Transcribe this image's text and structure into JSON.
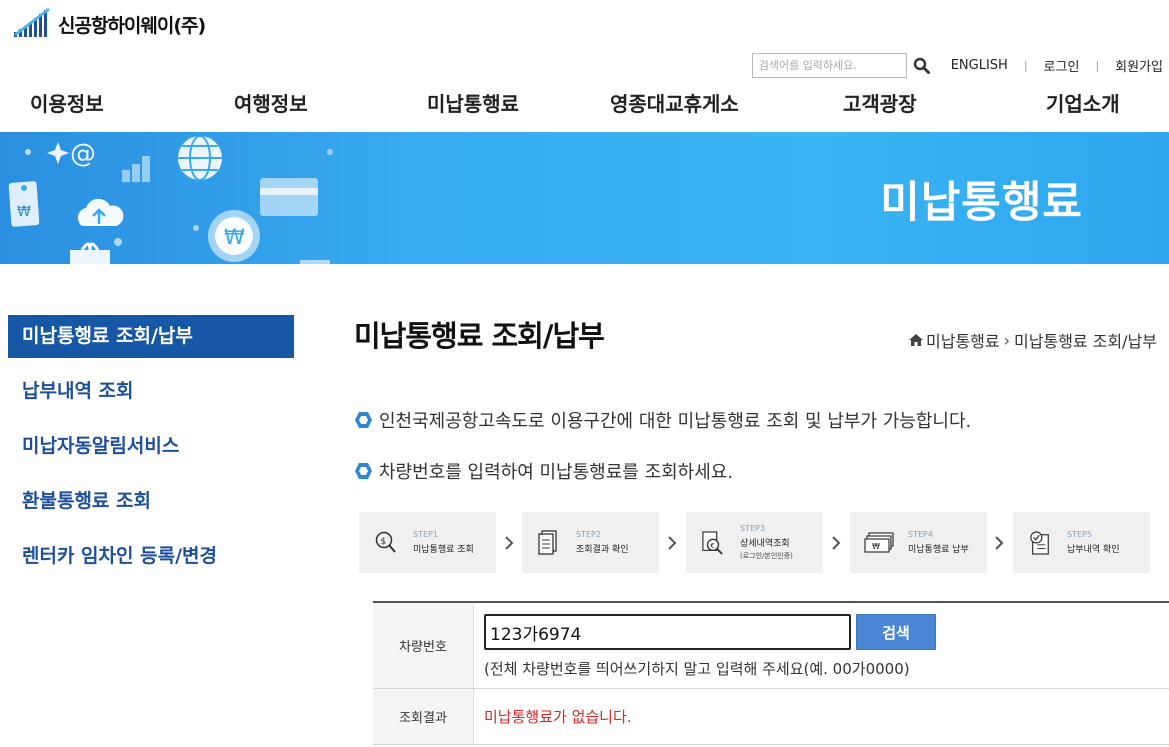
{
  "logo": {
    "text": "신공항하이웨이(주)"
  },
  "util": {
    "search_placeholder": "검색어를 입력하세요.",
    "links": [
      "ENGLISH",
      "로그인",
      "회원가입"
    ],
    "separator": "|"
  },
  "gnb": [
    "이용정보",
    "여행정보",
    "미납통행료",
    "영종대교휴게소",
    "고객광장",
    "기업소개"
  ],
  "banner": {
    "title": "미납통행료"
  },
  "lnb": [
    "미납통행료 조회/납부",
    "납부내역 조회",
    "미납자동알림서비스",
    "환불통행료 조회",
    "렌터카 임차인 등록/변경"
  ],
  "page": {
    "title": "미납통행료 조회/납부",
    "breadcrumb": [
      "미납통행료",
      "미납통행료 조회/납부"
    ],
    "chevron": "›",
    "info": [
      "인천국제공항고속도로 이용구간에 대한 미납통행료 조회 및 납부가 가능합니다.",
      "차량번호를 입력하여 미납통행료를 조회하세요."
    ]
  },
  "steps": [
    {
      "num": "STEP1",
      "name": "미납통행료 조회",
      "sub": "",
      "icon": "search-coin-icon"
    },
    {
      "num": "STEP2",
      "name": "조회결과 확인",
      "sub": "",
      "icon": "document-icon"
    },
    {
      "num": "STEP3",
      "name": "상세내역조회",
      "sub": "(로그인/본인인증)",
      "icon": "document-search-icon"
    },
    {
      "num": "STEP4",
      "name": "미납통행료 납부",
      "sub": "",
      "icon": "cash-icon"
    },
    {
      "num": "STEP5",
      "name": "납부내역 확인",
      "sub": "",
      "icon": "checklist-icon"
    }
  ],
  "form": {
    "plate_label": "차량번호",
    "plate_value": "123가6974",
    "search_button": "검색",
    "hint": "(전체 차량번호를 띄어쓰기하지 말고 입력해 주세요(예. 00가0000)",
    "result_label": "조회결과",
    "result_text": "미납통행료가 없습니다."
  },
  "colors": {
    "banner": "#38aaf0",
    "lnb_active": "#1658a5",
    "lnb_text": "#1d4f9a",
    "search_button": "#4b86d4",
    "result_text": "#d52828",
    "info_bullet": "#2e86d4"
  }
}
